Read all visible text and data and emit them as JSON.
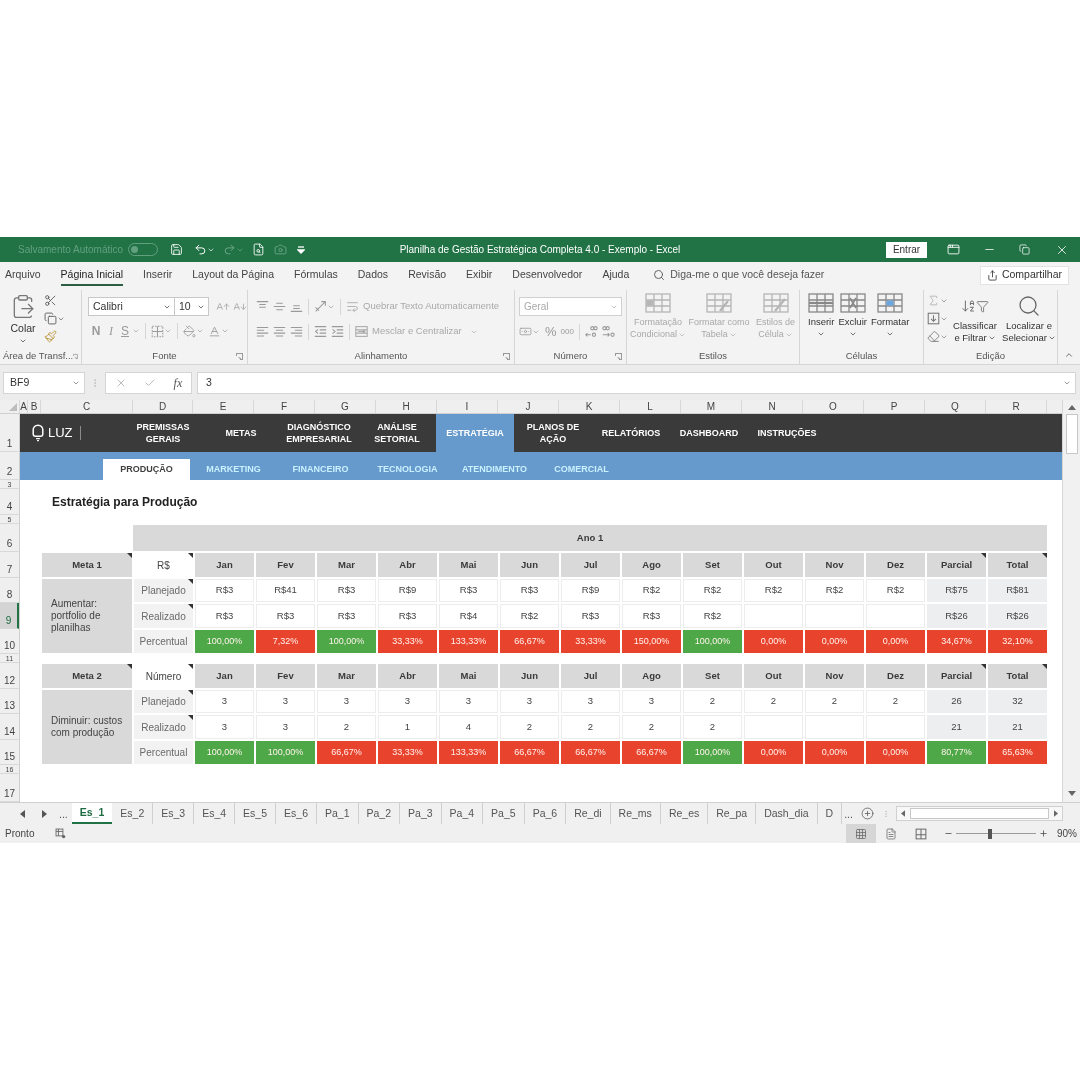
{
  "title_bar": {
    "autosave_label": "Salvamento Automático",
    "autosave_on": false,
    "title": "Planilha de Gestão Estratégica Completa 4.0 - Exemplo - Excel",
    "sign_in": "Entrar"
  },
  "menu_tabs": [
    {
      "label": "Arquivo",
      "selected": false
    },
    {
      "label": "Página Inicial",
      "selected": true
    },
    {
      "label": "Inserir",
      "selected": false
    },
    {
      "label": "Layout da Página",
      "selected": false
    },
    {
      "label": "Fórmulas",
      "selected": false
    },
    {
      "label": "Dados",
      "selected": false
    },
    {
      "label": "Revisão",
      "selected": false
    },
    {
      "label": "Exibir",
      "selected": false
    },
    {
      "label": "Desenvolvedor",
      "selected": false
    },
    {
      "label": "Ajuda",
      "selected": false
    }
  ],
  "tell_me": {
    "placeholder": "Diga-me o que você deseja fazer"
  },
  "share": "Compartilhar",
  "ribbon": {
    "clipboard": {
      "label": "Área de Transf...",
      "paste": "Colar"
    },
    "font": {
      "label": "Fonte",
      "name": "Calibri",
      "size": "10",
      "bold": "N",
      "italic": "I",
      "underline": "S"
    },
    "alignment": {
      "label": "Alinhamento",
      "wrap": {
        "label": "Quebrar Texto Automaticamente",
        "disabled": true
      },
      "merge": {
        "label": "Mesclar e Centralizar",
        "disabled": true
      }
    },
    "number": {
      "label": "Número",
      "format": "Geral",
      "percent": "%",
      "thousands": "000"
    },
    "styles": {
      "label": "Estilos",
      "buttons": [
        {
          "kind": "conditional",
          "label": "Formatação\nCondicional",
          "disabled": true
        },
        {
          "kind": "table",
          "label": "Formatar como\nTabela",
          "disabled": true
        },
        {
          "kind": "cell",
          "label": "Estilos de\nCélula",
          "disabled": true
        }
      ]
    },
    "cells": {
      "label": "Células",
      "buttons": [
        {
          "kind": "insert",
          "label": "Inserir",
          "disabled": false
        },
        {
          "kind": "delete",
          "label": "Excluir",
          "disabled": false
        },
        {
          "kind": "format",
          "label": "Formatar",
          "disabled": false
        }
      ]
    },
    "editing": {
      "label": "Edição",
      "buttons": [
        {
          "kind": "sort",
          "label": "Classificar\ne Filtrar"
        },
        {
          "kind": "find",
          "label": "Localizar e\nSelecionar"
        }
      ]
    }
  },
  "formula_bar": {
    "name_box": "BF9",
    "function_label": "fx",
    "value": "3"
  },
  "columns": [
    "A",
    "B",
    "C",
    "D",
    "E",
    "F",
    "G",
    "H",
    "I",
    "J",
    "K",
    "L",
    "M",
    "N",
    "O",
    "P",
    "Q",
    "R"
  ],
  "rows": [
    {
      "label": "1",
      "selected": false
    },
    {
      "label": "2",
      "selected": false
    },
    {
      "label": "3",
      "selected": false
    },
    {
      "label": "4",
      "selected": false
    },
    {
      "label": "5",
      "selected": false
    },
    {
      "label": "6",
      "selected": false
    },
    {
      "label": "7",
      "selected": false
    },
    {
      "label": "8",
      "selected": false
    },
    {
      "label": "9",
      "selected": true
    },
    {
      "label": "10",
      "selected": false
    },
    {
      "label": "11",
      "selected": false
    },
    {
      "label": "12",
      "selected": false
    },
    {
      "label": "13",
      "selected": false
    },
    {
      "label": "14",
      "selected": false
    },
    {
      "label": "15",
      "selected": false
    },
    {
      "label": "16",
      "selected": false
    },
    {
      "label": "17",
      "selected": false
    }
  ],
  "sheet": {
    "nav": {
      "logo": "LUZ",
      "items": [
        {
          "label": "PREMISSAS\nGERAIS",
          "selected": false
        },
        {
          "label": "METAS",
          "selected": false
        },
        {
          "label": "DIAGNÓSTICO\nEMPRESARIAL",
          "selected": false
        },
        {
          "label": "ANÁLISE\nSETORIAL",
          "selected": false
        },
        {
          "label": "ESTRATÉGIA",
          "selected": true
        },
        {
          "label": "PLANOS DE\nAÇÃO",
          "selected": false
        },
        {
          "label": "RELATÓRIOS",
          "selected": false
        },
        {
          "label": "DASHBOARD",
          "selected": false
        },
        {
          "label": "INSTRUÇÕES",
          "selected": false
        }
      ]
    },
    "subnav": [
      {
        "label": "PRODUÇÃO",
        "selected": true
      },
      {
        "label": "MARKETING",
        "selected": false
      },
      {
        "label": "FINANCEIRO",
        "selected": false
      },
      {
        "label": "TECNOLOGIA",
        "selected": false
      },
      {
        "label": "ATENDIMENTO",
        "selected": false
      },
      {
        "label": "COMERCIAL",
        "selected": false
      }
    ],
    "heading": "Estratégia para Produção",
    "period": "Ano 1",
    "goals": [
      {
        "title": "Meta 1",
        "title_note": true,
        "unit": "R$",
        "unit_note": true,
        "description": "Aumentar: portfolio de planilhas",
        "months": [
          "Jan",
          "Fev",
          "Mar",
          "Abr",
          "Mai",
          "Jun",
          "Jul",
          "Ago",
          "Set",
          "Out",
          "Nov",
          "Dez"
        ],
        "summary_columns": [
          {
            "label": "Parcial",
            "note": true
          },
          {
            "label": "Total",
            "note": true
          }
        ],
        "rows": [
          {
            "kind": "value",
            "label": "Planejado",
            "note": true,
            "cells": [
              "R$3",
              "R$41",
              "R$3",
              "R$9",
              "R$3",
              "R$3",
              "R$9",
              "R$2",
              "R$2",
              "R$2",
              "R$2",
              "R$2"
            ],
            "summary": [
              "R$75",
              "R$81"
            ]
          },
          {
            "kind": "value",
            "label": "Realizado",
            "note": true,
            "cells": [
              "R$3",
              "R$3",
              "R$3",
              "R$3",
              "R$4",
              "R$2",
              "R$3",
              "R$3",
              "R$2",
              null,
              null,
              null
            ],
            "summary": [
              "R$26",
              "R$26"
            ]
          },
          {
            "kind": "percent",
            "label": "Percentual",
            "note": false,
            "cells": [
              {
                "text": "100,00%",
                "color": "#4ea847"
              },
              {
                "text": "7,32%",
                "color": "#e8432d"
              },
              {
                "text": "100,00%",
                "color": "#4ea847"
              },
              {
                "text": "33,33%",
                "color": "#e8432d"
              },
              {
                "text": "133,33%",
                "color": "#e8432d"
              },
              {
                "text": "66,67%",
                "color": "#e8432d"
              },
              {
                "text": "33,33%",
                "color": "#e8432d"
              },
              {
                "text": "150,00%",
                "color": "#e8432d"
              },
              {
                "text": "100,00%",
                "color": "#4ea847"
              },
              {
                "text": "0,00%",
                "color": "#e8432d"
              },
              {
                "text": "0,00%",
                "color": "#e8432d"
              },
              {
                "text": "0,00%",
                "color": "#e8432d"
              }
            ],
            "summary": [
              {
                "text": "34,67%",
                "color": "#e8432d"
              },
              {
                "text": "32,10%",
                "color": "#e8432d"
              }
            ]
          }
        ]
      },
      {
        "title": "Meta 2",
        "title_note": true,
        "unit": "Número",
        "unit_note": true,
        "description": "Diminuir: custos com produção",
        "months": [
          "Jan",
          "Fev",
          "Mar",
          "Abr",
          "Mai",
          "Jun",
          "Jul",
          "Ago",
          "Set",
          "Out",
          "Nov",
          "Dez"
        ],
        "summary_columns": [
          {
            "label": "Parcial",
            "note": true
          },
          {
            "label": "Total",
            "note": true
          }
        ],
        "rows": [
          {
            "kind": "value",
            "label": "Planejado",
            "note": true,
            "cells": [
              "3",
              "3",
              "3",
              "3",
              "3",
              "3",
              "3",
              "3",
              "2",
              "2",
              "2",
              "2"
            ],
            "summary": [
              "26",
              "32"
            ]
          },
          {
            "kind": "value",
            "label": "Realizado",
            "note": true,
            "cells": [
              "3",
              "3",
              "2",
              "1",
              "4",
              "2",
              "2",
              "2",
              "2",
              null,
              null,
              null
            ],
            "summary": [
              "21",
              "21"
            ]
          },
          {
            "kind": "percent",
            "label": "Percentual",
            "note": false,
            "cells": [
              {
                "text": "100,00%",
                "color": "#4ea847"
              },
              {
                "text": "100,00%",
                "color": "#4ea847"
              },
              {
                "text": "66,67%",
                "color": "#e8432d"
              },
              {
                "text": "33,33%",
                "color": "#e8432d"
              },
              {
                "text": "133,33%",
                "color": "#e8432d"
              },
              {
                "text": "66,67%",
                "color": "#e8432d"
              },
              {
                "text": "66,67%",
                "color": "#e8432d"
              },
              {
                "text": "66,67%",
                "color": "#e8432d"
              },
              {
                "text": "100,00%",
                "color": "#4ea847"
              },
              {
                "text": "0,00%",
                "color": "#e8432d"
              },
              {
                "text": "0,00%",
                "color": "#e8432d"
              },
              {
                "text": "0,00%",
                "color": "#e8432d"
              }
            ],
            "summary": [
              {
                "text": "80,77%",
                "color": "#4ea847"
              },
              {
                "text": "65,63%",
                "color": "#e8432d"
              }
            ]
          }
        ]
      }
    ]
  },
  "sheet_tabs": {
    "more_left": "...",
    "tabs": [
      {
        "label": "Es_1",
        "selected": true
      },
      {
        "label": "Es_2",
        "selected": false
      },
      {
        "label": "Es_3",
        "selected": false
      },
      {
        "label": "Es_4",
        "selected": false
      },
      {
        "label": "Es_5",
        "selected": false
      },
      {
        "label": "Es_6",
        "selected": false
      },
      {
        "label": "Pa_1",
        "selected": false
      },
      {
        "label": "Pa_2",
        "selected": false
      },
      {
        "label": "Pa_3",
        "selected": false
      },
      {
        "label": "Pa_4",
        "selected": false
      },
      {
        "label": "Pa_5",
        "selected": false
      },
      {
        "label": "Pa_6",
        "selected": false
      },
      {
        "label": "Re_di",
        "selected": false
      },
      {
        "label": "Re_ms",
        "selected": false
      },
      {
        "label": "Re_es",
        "selected": false
      },
      {
        "label": "Re_pa",
        "selected": false
      },
      {
        "label": "Dash_dia",
        "selected": false
      },
      {
        "label": "D",
        "selected": false
      }
    ],
    "more_right": "..."
  },
  "status_bar": {
    "status": "Pronto",
    "views": [
      {
        "kind": "normal",
        "selected": true
      },
      {
        "kind": "page_layout",
        "selected": false
      },
      {
        "kind": "page_break",
        "selected": false
      }
    ],
    "zoom": {
      "level": 0.42,
      "reading": "90%"
    }
  }
}
